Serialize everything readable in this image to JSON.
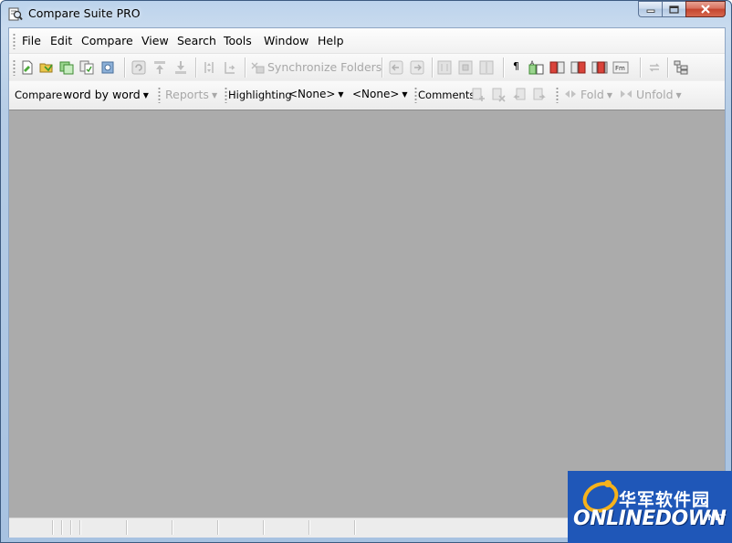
{
  "window": {
    "title": "Compare Suite PRO"
  },
  "menu": {
    "items": [
      "File",
      "Edit",
      "Compare",
      "View",
      "Search",
      "Tools",
      "Window",
      "Help"
    ]
  },
  "toolbar": {
    "sync_folders_label": "Synchronize Folders",
    "pilcrow": "¶"
  },
  "toolbar2": {
    "compare_label": "Compare",
    "compare_mode": "word by word",
    "reports_label": "Reports",
    "highlighting_label": "Highlighting",
    "highlight_1": "<None>",
    "highlight_2": "<None>",
    "comments_label": "Comments",
    "fold_label": "Fold",
    "unfold_label": "Unfold"
  },
  "logo": {
    "cn_text": "华军软件园",
    "en_text": "ONLINEDOWN",
    "net_text": ".NET"
  },
  "colors": {
    "workspace": "#ababab",
    "chrome": "#f0f0f0",
    "logo_bg": "#1f57b8"
  }
}
